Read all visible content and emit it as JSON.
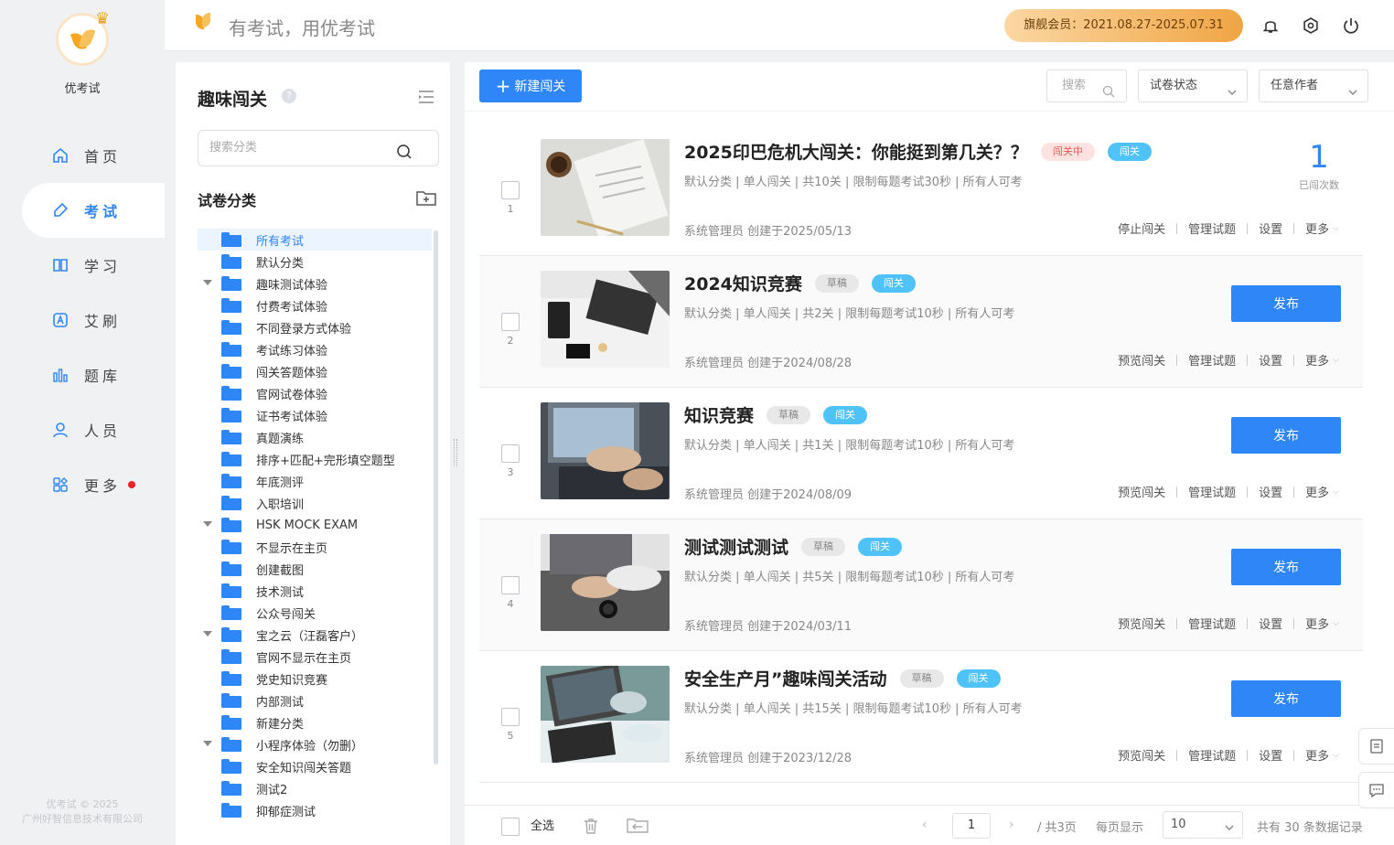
{
  "brand": {
    "name": "优考试",
    "copyright_line1": "优考试 © 2025",
    "copyright_line2": "广州好智信息技术有限公司"
  },
  "nav": [
    {
      "label": "首页",
      "icon": "home-icon"
    },
    {
      "label": "考试",
      "icon": "exam-icon",
      "active": true
    },
    {
      "label": "学习",
      "icon": "book-icon"
    },
    {
      "label": "艾刷",
      "icon": "a-badge-icon"
    },
    {
      "label": "题库",
      "icon": "bar-chart-icon"
    },
    {
      "label": "人员",
      "icon": "user-icon"
    },
    {
      "label": "更多",
      "icon": "grid-more-icon",
      "dot": true
    }
  ],
  "topbar": {
    "slogan": "有考试，用优考试",
    "member": "旗舰会员：2021.08.27-2025.07.31"
  },
  "category": {
    "title": "趣味闯关",
    "help": "?",
    "search_placeholder": "搜索分类",
    "section_title": "试卷分类",
    "items": [
      {
        "label": "所有考试",
        "selected": true
      },
      {
        "label": "默认分类"
      },
      {
        "label": "趣味测试体验",
        "expand": true
      },
      {
        "label": "付费考试体验"
      },
      {
        "label": "不同登录方式体验"
      },
      {
        "label": "考试练习体验"
      },
      {
        "label": "闯关答题体验"
      },
      {
        "label": "官网试卷体验"
      },
      {
        "label": "证书考试体验"
      },
      {
        "label": "真题演练"
      },
      {
        "label": "排序+匹配+完形填空题型"
      },
      {
        "label": "年底测评"
      },
      {
        "label": "入职培训"
      },
      {
        "label": "HSK MOCK EXAM",
        "expand": true
      },
      {
        "label": "不显示在主页"
      },
      {
        "label": "创建截图"
      },
      {
        "label": "技术测试"
      },
      {
        "label": "公众号闯关"
      },
      {
        "label": "宝之云（汪磊客户）",
        "expand": true
      },
      {
        "label": "官网不显示在主页"
      },
      {
        "label": "党史知识竞赛"
      },
      {
        "label": "内部测试"
      },
      {
        "label": "新建分类"
      },
      {
        "label": "小程序体验（勿删）",
        "expand": true
      },
      {
        "label": "安全知识闯关答题"
      },
      {
        "label": "测试2"
      },
      {
        "label": "抑郁症测试"
      }
    ]
  },
  "toolbar": {
    "new_label": "新建闯关",
    "search_placeholder": "搜索",
    "status_select": "试卷状态",
    "author_select": "任意作者"
  },
  "cards": [
    {
      "num": "1",
      "title": "2025印巴危机大闯关：你能挺到第几关？？",
      "status_tag": "闯关中",
      "type_tag": "闯关",
      "meta": "默认分类 | 单人闯关 | 共10关 | 限制每题考试30秒 | 所有人可考",
      "creator": "系统管理员 创建于2025/05/13",
      "actions": [
        "停止闯关",
        "管理试题",
        "设置",
        "更多"
      ],
      "stat_value": "1",
      "stat_label": "已闯次数",
      "thumb": "desk-papers"
    },
    {
      "num": "2",
      "title": "2024知识竞赛",
      "status_tag": "草稿",
      "type_tag": "闯关",
      "meta": "默认分类 | 单人闯关 | 共2关 | 限制每题考试10秒 | 所有人可考",
      "creator": "系统管理员 创建于2024/08/28",
      "actions": [
        "预览闯关",
        "管理试题",
        "设置",
        "更多"
      ],
      "publish": "发布",
      "thumb": "desk-laptop"
    },
    {
      "num": "3",
      "title": "知识竞赛",
      "status_tag": "草稿",
      "type_tag": "闯关",
      "meta": "默认分类 | 单人闯关 | 共1关 | 限制每题考试10秒 | 所有人可考",
      "creator": "系统管理员 创建于2024/08/09",
      "actions": [
        "预览闯关",
        "管理试题",
        "设置",
        "更多"
      ],
      "publish": "发布",
      "thumb": "typing"
    },
    {
      "num": "4",
      "title": "测试测试测试",
      "status_tag": "草稿",
      "type_tag": "闯关",
      "meta": "默认分类 | 单人闯关 | 共5关 | 限制每题考试10秒 | 所有人可考",
      "creator": "系统管理员 创建于2024/03/11",
      "actions": [
        "预览闯关",
        "管理试题",
        "设置",
        "更多"
      ],
      "publish": "发布",
      "thumb": "typing-watch"
    },
    {
      "num": "5",
      "title": "安全生产月”趣味闯关活动",
      "status_tag": "草稿",
      "type_tag": "闯关",
      "meta": "默认分类 | 单人闯关 | 共15关 | 限制每题考试10秒 | 所有人可考",
      "creator": "系统管理员 创建于2023/12/28",
      "actions": [
        "预览闯关",
        "管理试题",
        "设置",
        "更多"
      ],
      "publish": "发布",
      "thumb": "meeting-laptop"
    }
  ],
  "footer": {
    "select_all": "全选",
    "page": "1",
    "total_pages": "/ 共3页",
    "per_page_label": "每页显示",
    "page_size": "10",
    "total_records": "共有 30 条数据记录"
  },
  "colors": {
    "primary": "#2f86f6",
    "accent": "#f5a623",
    "danger": "#f5222d",
    "tag_blue": "#4fc3f7"
  }
}
